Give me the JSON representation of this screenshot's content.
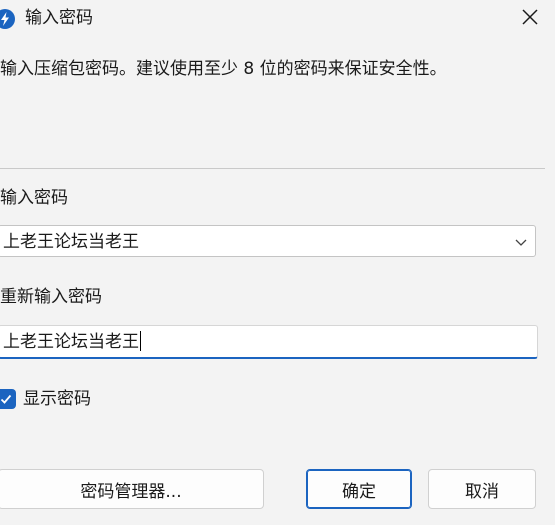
{
  "dialog": {
    "title": "输入密码",
    "description": "输入压缩包密码。建议使用至少 8 位的密码来保证安全性。"
  },
  "password": {
    "label": "输入密码",
    "value": "上老王论坛当老王"
  },
  "confirm_password": {
    "label": "重新输入密码",
    "value": "上老王论坛当老王"
  },
  "show_password": {
    "label": "显示密码",
    "checked": true
  },
  "buttons": {
    "manager": "密码管理器...",
    "ok": "确定",
    "cancel": "取消"
  },
  "icons": {
    "app": "app-logo-icon",
    "close": "close-icon",
    "dropdown": "chevron-down-icon",
    "check": "checkmark-icon"
  },
  "colors": {
    "accent": "#1b64c0",
    "background": "#f3f3f3"
  }
}
